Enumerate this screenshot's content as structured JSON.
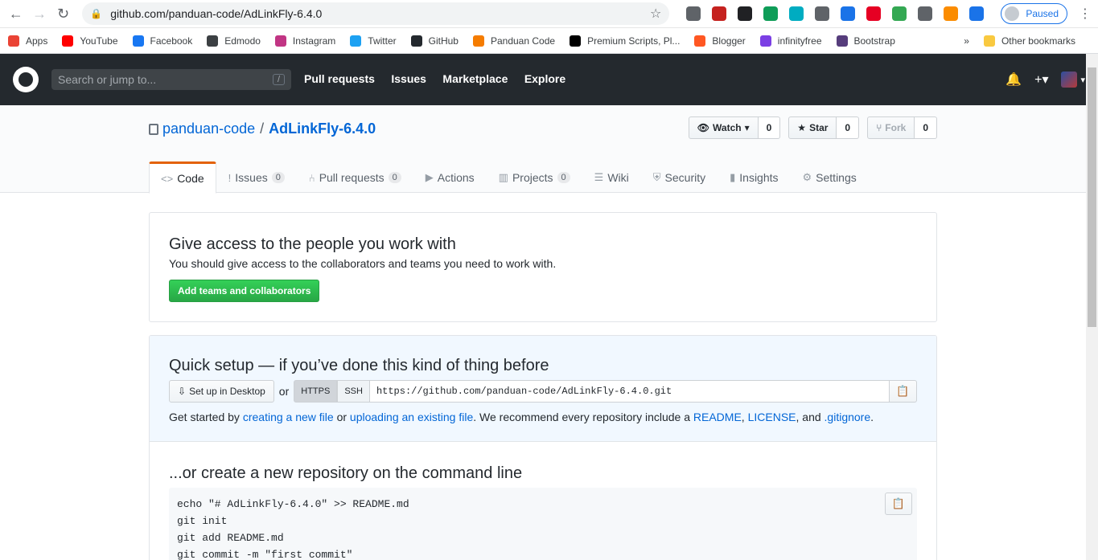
{
  "browser": {
    "url": "github.com/panduan-code/AdLinkFly-6.4.0",
    "profile_status": "Paused",
    "extension_colors": [
      "#5f6368",
      "#c5221f",
      "#202124",
      "#0f9d58",
      "#00acc1",
      "#5f6368",
      "#1a73e8",
      "#e60023",
      "#34a853",
      "#5f6368",
      "#fb8c00",
      "#1a73e8"
    ]
  },
  "bookmarks": {
    "items": [
      {
        "label": "Apps",
        "color": "#ea4335"
      },
      {
        "label": "YouTube",
        "color": "#ff0000"
      },
      {
        "label": "Facebook",
        "color": "#1877f2"
      },
      {
        "label": "Edmodo",
        "color": "#3c4043"
      },
      {
        "label": "Instagram",
        "color": "#c13584"
      },
      {
        "label": "Twitter",
        "color": "#1da1f2"
      },
      {
        "label": "GitHub",
        "color": "#24292e"
      },
      {
        "label": "Panduan Code",
        "color": "#f57c00"
      },
      {
        "label": "Premium Scripts, Pl...",
        "color": "#000000"
      },
      {
        "label": "Blogger",
        "color": "#ff5722"
      },
      {
        "label": "infinityfree",
        "color": "#7b3fe4"
      },
      {
        "label": "Bootstrap",
        "color": "#563d7c"
      }
    ],
    "more": "»",
    "other": "Other bookmarks"
  },
  "header": {
    "search_placeholder": "Search or jump to...",
    "search_key": "/",
    "nav": [
      "Pull requests",
      "Issues",
      "Marketplace",
      "Explore"
    ]
  },
  "repo": {
    "owner": "panduan-code",
    "separator": "/",
    "name": "AdLinkFly-6.4.0",
    "watch_label": "Watch",
    "watch_count": "0",
    "star_label": "Star",
    "star_count": "0",
    "fork_label": "Fork",
    "fork_count": "0"
  },
  "tabs": [
    {
      "label": "Code",
      "icon": "<>",
      "count": ""
    },
    {
      "label": "Issues",
      "icon": "!",
      "count": "0"
    },
    {
      "label": "Pull requests",
      "icon": "⑃",
      "count": "0"
    },
    {
      "label": "Actions",
      "icon": "▶",
      "count": ""
    },
    {
      "label": "Projects",
      "icon": "▥",
      "count": "0"
    },
    {
      "label": "Wiki",
      "icon": "☰",
      "count": ""
    },
    {
      "label": "Security",
      "icon": "⛨",
      "count": ""
    },
    {
      "label": "Insights",
      "icon": "▮",
      "count": ""
    },
    {
      "label": "Settings",
      "icon": "⚙",
      "count": ""
    }
  ],
  "access": {
    "title": "Give access to the people you work with",
    "desc": "You should give access to the collaborators and teams you need to work with.",
    "button": "Add teams and collaborators"
  },
  "quick": {
    "title": "Quick setup — if you’ve done this kind of thing before",
    "desktop_button": "Set up in Desktop",
    "or": "or",
    "https": "HTTPS",
    "ssh": "SSH",
    "clone_url": "https://github.com/panduan-code/AdLinkFly-6.4.0.git",
    "desc_1": "Get started by",
    "link_new_file": "creating a new file",
    "desc_2": "or",
    "link_upload": "uploading an existing file",
    "desc_3": ". We recommend every repository include a",
    "link_readme": "README",
    "desc_comma": ",",
    "link_license": "LICENSE",
    "desc_4": ", and",
    "link_gitignore": ".gitignore",
    "desc_5": "."
  },
  "cmdline": {
    "title": "...or create a new repository on the command line",
    "lines": [
      "echo \"# AdLinkFly-6.4.0\" >> README.md",
      "git init",
      "git add README.md",
      "git commit -m \"first commit\""
    ]
  }
}
